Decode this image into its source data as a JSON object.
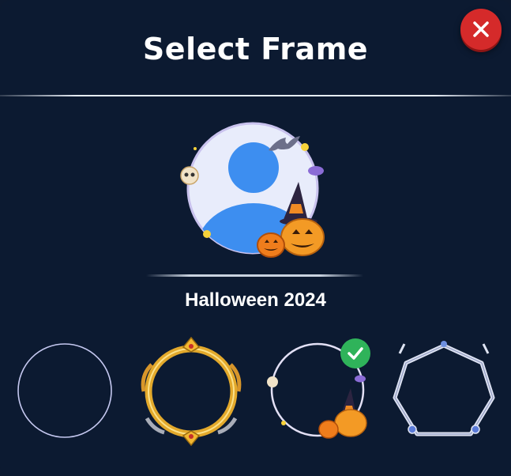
{
  "dialog": {
    "title": "Select Frame",
    "close_icon": "close-icon"
  },
  "preview": {
    "avatar_icon": "user-avatar-icon",
    "frame_theme": "halloween",
    "selected_frame_name": "Halloween 2024"
  },
  "frames": [
    {
      "id": "none",
      "icon": "plain-circle-frame-icon",
      "selected": false
    },
    {
      "id": "golden",
      "icon": "golden-ornate-frame-icon",
      "selected": false
    },
    {
      "id": "halloween",
      "icon": "halloween-frame-icon",
      "selected": true
    },
    {
      "id": "silver",
      "icon": "silver-ornate-frame-icon",
      "selected": false
    }
  ],
  "colors": {
    "background": "#0c1a31",
    "close_button": "#d52a2a",
    "check_badge": "#2fb35a",
    "avatar_blue": "#3d8ef0",
    "avatar_bg": "#e8ecfb"
  }
}
